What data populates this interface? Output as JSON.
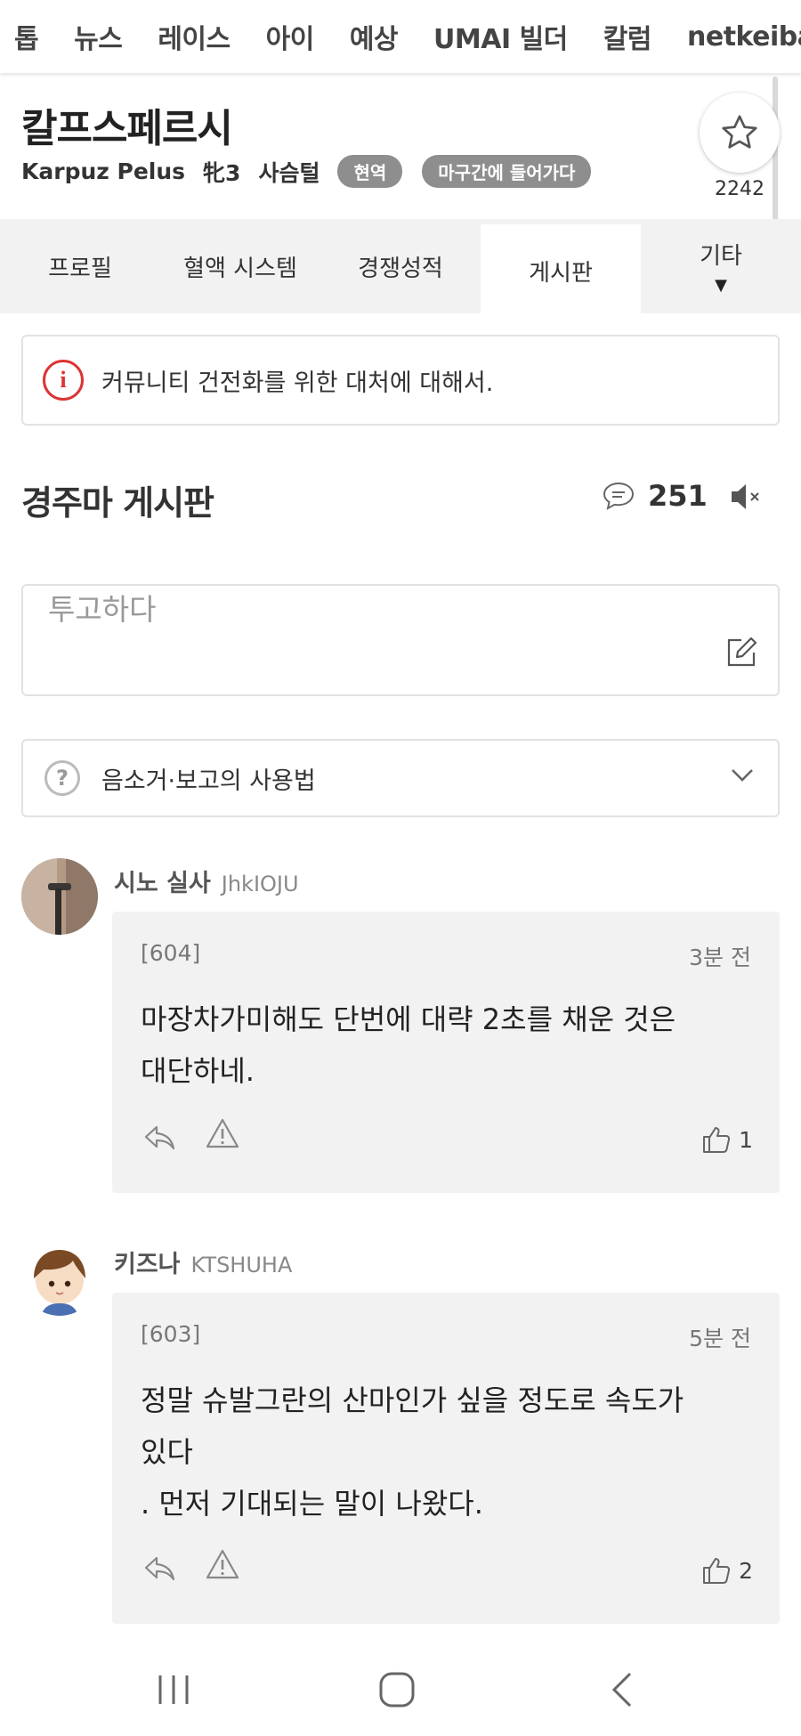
{
  "topnav": {
    "items": [
      "톱",
      "뉴스",
      "레이스",
      "아이",
      "예상",
      "UMAI 빌더",
      "칼럼",
      "netkeibaTV"
    ]
  },
  "horse": {
    "name": "칼프스페르시",
    "roman_name": "Karpuz Pelus",
    "sex_age": "牝3",
    "coat": "사슴털",
    "badges": [
      "현역",
      "마구간에 들어가다"
    ],
    "favorite_count": "2242",
    "favorite_icon": "star-icon"
  },
  "tabs": {
    "items": [
      {
        "label": "프로필",
        "active": false
      },
      {
        "label": "혈액 시스템",
        "active": false
      },
      {
        "label": "경쟁성적",
        "active": false
      },
      {
        "label": "게시판",
        "active": true
      },
      {
        "label": "기타",
        "active": false,
        "caret": "▼"
      }
    ]
  },
  "notice": {
    "text": "커뮤니티 건전화를 위한 대처에 대해서.",
    "icon": "info-icon",
    "icon_glyph": "i",
    "color": "#d33333"
  },
  "board": {
    "title": "경주마 게시판",
    "comment_count": "251",
    "comment_icon": "speech-bubble-icon",
    "mute_icon": "speaker-muted-icon"
  },
  "post": {
    "placeholder": "투고하다",
    "icon": "edit-icon"
  },
  "usage": {
    "text": "음소거·보고의 사용법",
    "icon": "question-icon",
    "icon_glyph": "?"
  },
  "comments": [
    {
      "user": "시노 실사",
      "user_id": "JhkIOJU",
      "number": "[604]",
      "time": "3분 전",
      "body": [
        "마장차가미해도 단번에 대략 2초를 채운 것은",
        "대단하네."
      ],
      "likes": "1"
    },
    {
      "user": "키즈나",
      "user_id": "KTSHUHA",
      "number": "[603]",
      "time": "5분 전",
      "body": [
        "정말 슈발그란의 산마인가 싶을 정도로 속도가",
        "있다",
        ". 먼저 기대되는 말이 나왔다."
      ],
      "likes": "2"
    }
  ],
  "system_nav": {
    "icons": [
      "recent-apps-icon",
      "home-icon",
      "back-icon"
    ]
  }
}
